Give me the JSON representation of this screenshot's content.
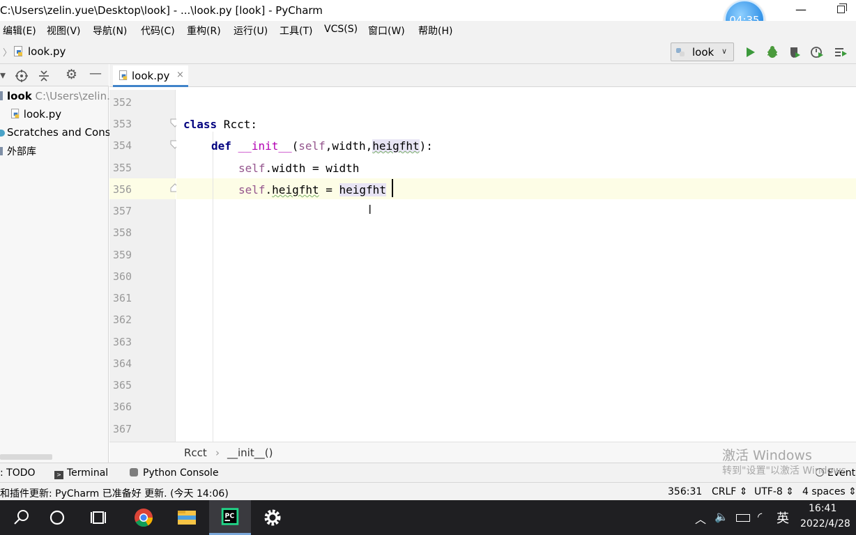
{
  "window": {
    "title": "C:\\Users\\zelin.yue\\Desktop\\look] - ...\\look.py [look] - PyCharm",
    "timer": "04:35"
  },
  "menu": {
    "items": [
      "编辑(E)",
      "视图(V)",
      "导航(N)",
      "代码(C)",
      "重构(R)",
      "运行(U)",
      "工具(T)",
      "VCS(S)",
      "窗口(W)",
      "帮助(H)"
    ]
  },
  "navbar": {
    "file": "look.py",
    "run_config": "look"
  },
  "project": {
    "root_name": "look",
    "root_path": "C:\\Users\\zelin.",
    "file": "look.py",
    "scratches": "Scratches and Conso",
    "external": "外部库"
  },
  "editor": {
    "tab": "look.py",
    "tab_close": "×",
    "line_numbers": [
      "352",
      "353",
      "354",
      "355",
      "356",
      "357",
      "358",
      "359",
      "360",
      "361",
      "362",
      "363",
      "364",
      "365",
      "366",
      "367"
    ],
    "code": {
      "l353_kw": "class",
      "l353_name": " Rcct:",
      "l354_kw": "def",
      "l354_sp": " ",
      "l354_fn": "__init__",
      "l354_open": "(",
      "l354_self": "self",
      "l354_mid": ",width,",
      "l354_param": "heigfht",
      "l354_close": "):",
      "l355_self": "self",
      "l355_rest": ".width = width",
      "l356_self": "self",
      "l356_dot": ".",
      "l356_attr": "heigfht",
      "l356_eq": " = ",
      "l356_val": "heigfht"
    }
  },
  "breadcrumbs": {
    "class": "Rcct",
    "sep": "›",
    "method": "__init__()"
  },
  "tool_windows": {
    "todo": ": TODO",
    "terminal": "Terminal",
    "python_console": "Python Console",
    "event_log": "Event"
  },
  "watermark": {
    "line1": "激活 Windows",
    "line2": "转到\"设置\"以激活 Windows"
  },
  "status": {
    "message": "和插件更新: PyCharm 已准备好 更新. (今天 14:06)",
    "position": "356:31",
    "line_ending": "CRLF ⇕",
    "encoding": "UTF-8 ⇕",
    "indent": "4 spaces ⇕"
  },
  "taskbar": {
    "ime": "英",
    "time": "16:41",
    "date": "2022/4/28"
  },
  "colors": {
    "accent": "#4083c9",
    "keyword": "#00007f",
    "self": "#94558d",
    "dunder": "#b200b2",
    "current_line": "#fdfde6",
    "run_green": "#3c9a3c"
  }
}
